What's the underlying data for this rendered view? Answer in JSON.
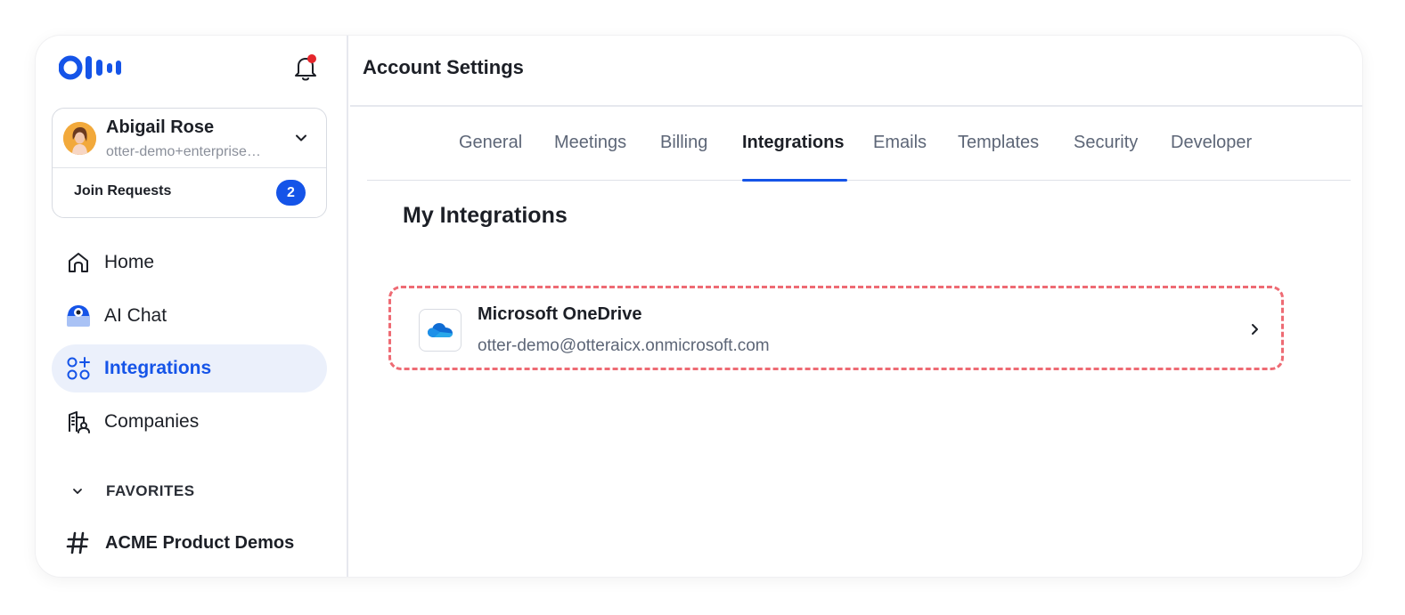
{
  "brand": {
    "logo": "otter-logo",
    "accent": "#1554E8",
    "notification_dot": "#E5262C"
  },
  "user": {
    "name": "Abigail Rose",
    "email": "otter-demo+enterprise@otter.ai",
    "join_requests_label": "Join Requests",
    "join_requests_count": "2"
  },
  "sidebar": {
    "items": [
      {
        "label": "Home",
        "icon": "home-icon"
      },
      {
        "label": "AI Chat",
        "icon": "ai-chat-icon"
      },
      {
        "label": "Integrations",
        "icon": "integrations-icon",
        "active": true
      },
      {
        "label": "Companies",
        "icon": "companies-icon"
      }
    ],
    "favorites_label": "FAVORITES",
    "channels": [
      {
        "label": "ACME Product Demos",
        "icon": "hash-icon"
      }
    ]
  },
  "header": {
    "title": "Account Settings"
  },
  "tabs": [
    {
      "label": "General"
    },
    {
      "label": "Meetings"
    },
    {
      "label": "Billing"
    },
    {
      "label": "Integrations",
      "active": true
    },
    {
      "label": "Emails"
    },
    {
      "label": "Templates"
    },
    {
      "label": "Security"
    },
    {
      "label": "Developer"
    }
  ],
  "main": {
    "section_title": "My Integrations",
    "integrations": [
      {
        "name": "Microsoft OneDrive",
        "account": "otter-demo@otteraicx.onmicrosoft.com",
        "icon": "onedrive-icon"
      }
    ]
  }
}
